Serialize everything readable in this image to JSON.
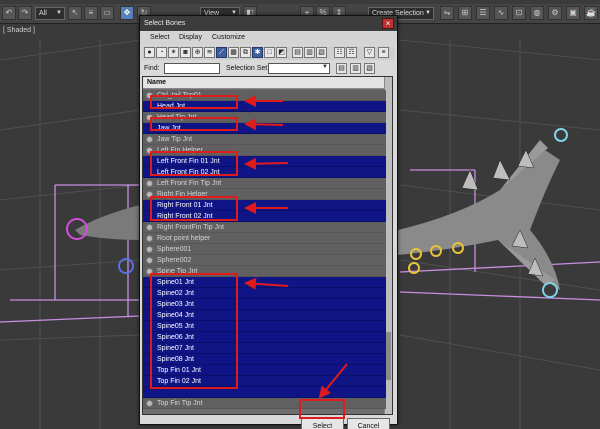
{
  "toolbar": {
    "filter_select": "All",
    "view_select": "View",
    "selection_set_select": "Create Selection Se",
    "icons": [
      "select-object-icon",
      "select-by-name-icon",
      "rectangle-selection-icon",
      "window-crossing-icon",
      "move-icon",
      "rotate-icon",
      "scale-icon",
      "snaps-toggle-icon",
      "angle-snap-icon",
      "percent-snap-icon",
      "spinner-snap-icon",
      "named-selection-icon",
      "mirror-icon",
      "align-icon",
      "layer-manager-icon",
      "curve-editor-icon",
      "schematic-view-icon",
      "material-editor-icon",
      "render-setup-icon",
      "render-frame-icon",
      "render-icon"
    ]
  },
  "viewport": {
    "label": "[ Shaded ]"
  },
  "dialog": {
    "title": "Select Bones",
    "close_glyph": "×",
    "menu": [
      "Select",
      "Display",
      "Customize"
    ],
    "find_label": "Find:",
    "find_value": "",
    "selection_set_label": "Selection Set:",
    "selection_set_value": "",
    "column_header": "Name",
    "rows": [
      {
        "label": "Ctrl_tail Top01",
        "selected": false,
        "icon": "helper-icon"
      },
      {
        "label": "Head Jnt",
        "selected": true,
        "icon": "bone-icon"
      },
      {
        "label": "Head Tip Jnt",
        "selected": false,
        "icon": "bone-icon"
      },
      {
        "label": "Jaw Jnt",
        "selected": true,
        "icon": "bone-icon"
      },
      {
        "label": "Jaw Tip Jnt",
        "selected": false,
        "icon": "bone-icon"
      },
      {
        "label": "Left Fin Helper",
        "selected": false,
        "icon": "helper-icon"
      },
      {
        "label": "Left Front Fin 01 Jnt",
        "selected": true,
        "icon": "bone-icon"
      },
      {
        "label": "Left Front Fin 02 Jnt",
        "selected": true,
        "icon": "bone-icon"
      },
      {
        "label": "Left Front Fin Tip Jnt",
        "selected": false,
        "icon": "bone-icon"
      },
      {
        "label": "Right Fin Helper",
        "selected": false,
        "icon": "helper-icon"
      },
      {
        "label": "Right Front 01 Jnt",
        "selected": true,
        "icon": "bone-icon"
      },
      {
        "label": "Right Front 02 Jnt",
        "selected": true,
        "icon": "bone-icon"
      },
      {
        "label": "Right FrontFin Tip Jnt",
        "selected": false,
        "icon": "bone-icon"
      },
      {
        "label": "Root point helper",
        "selected": false,
        "icon": "point-helper-icon"
      },
      {
        "label": "Sphere001",
        "selected": false,
        "icon": "sphere-icon"
      },
      {
        "label": "Sphere002",
        "selected": false,
        "icon": "sphere-icon"
      },
      {
        "label": "Spine Tip Jnt",
        "selected": false,
        "icon": "bone-icon"
      },
      {
        "label": "Spine01 Jnt",
        "selected": true,
        "icon": "bone-icon"
      },
      {
        "label": "Spine02 Jnt",
        "selected": true,
        "icon": "bone-icon"
      },
      {
        "label": "Spine03 Jnt",
        "selected": true,
        "icon": "bone-icon"
      },
      {
        "label": "Spine04 Jnt",
        "selected": true,
        "icon": "bone-icon"
      },
      {
        "label": "Spine05 Jnt",
        "selected": true,
        "icon": "bone-icon"
      },
      {
        "label": "Spine06 Jnt",
        "selected": true,
        "icon": "bone-icon"
      },
      {
        "label": "Spine07 Jnt",
        "selected": true,
        "icon": "bone-icon"
      },
      {
        "label": "Spine08 Jnt",
        "selected": true,
        "icon": "bone-icon"
      },
      {
        "label": "Top Fin 01 Jnt",
        "selected": true,
        "icon": "bone-icon"
      },
      {
        "label": "Top Fin 02 Jnt",
        "selected": true,
        "icon": "bone-icon"
      },
      {
        "label": "",
        "selected": true,
        "icon": "none"
      },
      {
        "label": "Top Fin Tip Jnt",
        "selected": false,
        "icon": "bone-icon"
      }
    ],
    "select_button": "Select",
    "cancel_button": "Cancel"
  },
  "colors": {
    "selection_blue": "#101585",
    "annotation_red": "#e01b1b",
    "grid_purple": "#c98ee0",
    "helper_yellow": "#e8c43a",
    "helper_cyan": "#7fd3e6",
    "helper_magenta": "#d04fe0"
  }
}
